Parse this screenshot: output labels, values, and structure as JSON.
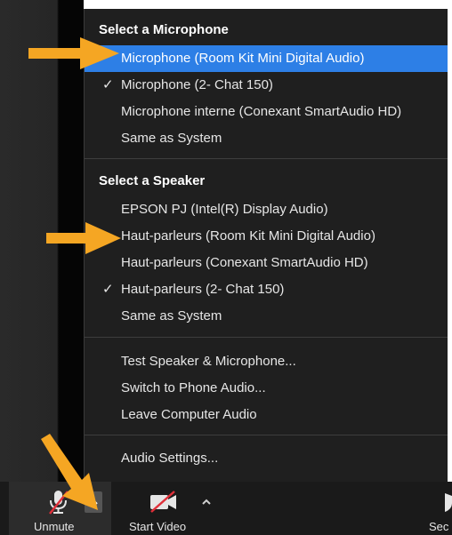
{
  "microphone_section": {
    "header": "Select a Microphone",
    "items": [
      {
        "label": "Microphone (Room Kit Mini Digital Audio)",
        "checked": false,
        "selected": true
      },
      {
        "label": "Microphone (2- Chat 150)",
        "checked": true,
        "selected": false
      },
      {
        "label": "Microphone interne (Conexant SmartAudio HD)",
        "checked": false,
        "selected": false
      },
      {
        "label": "Same as System",
        "checked": false,
        "selected": false
      }
    ]
  },
  "speaker_section": {
    "header": "Select a Speaker",
    "items": [
      {
        "label": "EPSON PJ (Intel(R) Display Audio)",
        "checked": false
      },
      {
        "label": "Haut-parleurs (Room Kit Mini Digital Audio)",
        "checked": false
      },
      {
        "label": "Haut-parleurs (Conexant SmartAudio HD)",
        "checked": false
      },
      {
        "label": "Haut-parleurs (2- Chat 150)",
        "checked": true
      },
      {
        "label": "Same as System",
        "checked": false
      }
    ]
  },
  "actions": {
    "test": "Test Speaker & Microphone...",
    "switch_phone": "Switch to Phone Audio...",
    "leave": "Leave Computer Audio"
  },
  "settings": "Audio Settings...",
  "toolbar": {
    "unmute_label": "Unmute",
    "start_video_label": "Start Video",
    "security_label_partial": "Sec"
  },
  "check_glyph": "✓",
  "colors": {
    "menu_bg": "#1f1f1f",
    "highlight": "#2d7fe6",
    "annotation_arrow": "#f5a623",
    "muted_red": "#e0303a"
  },
  "icons": [
    "microphone-muted-icon",
    "video-off-icon",
    "chevron-up-icon",
    "shield-icon",
    "arrow-annotation"
  ]
}
